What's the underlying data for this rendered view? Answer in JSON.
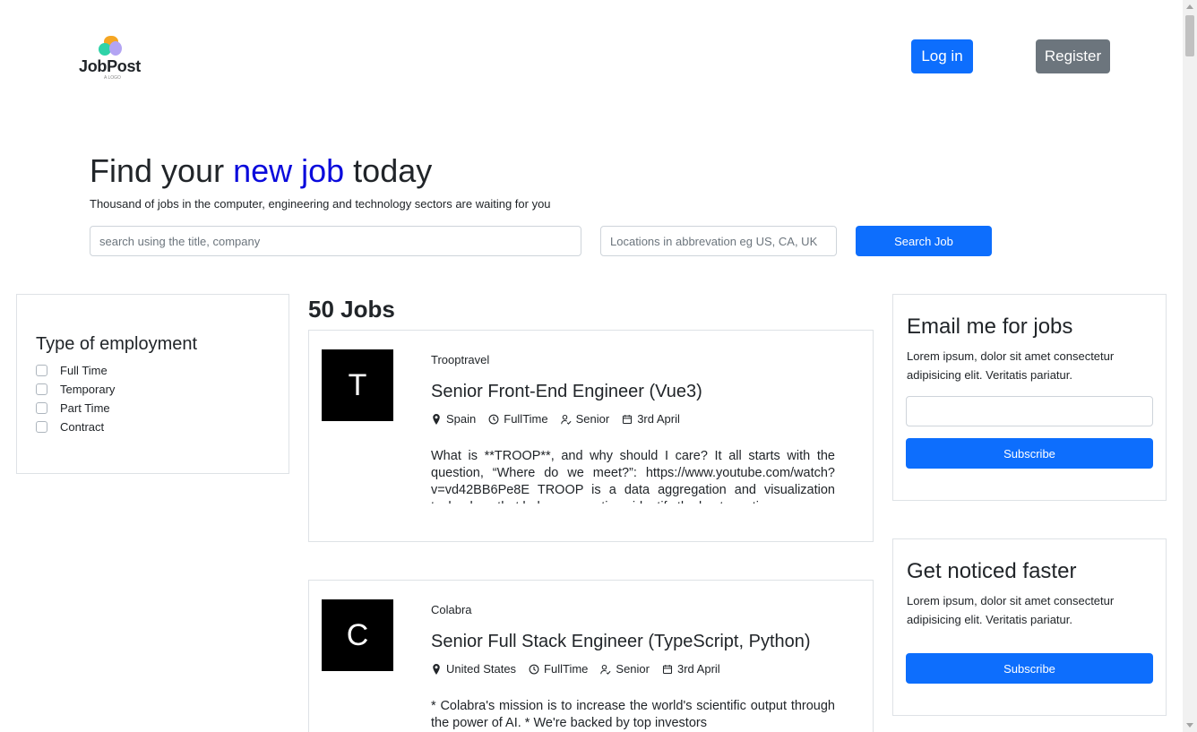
{
  "header": {
    "logo_text": "JobPost",
    "logo_sub": "A LOGO",
    "login_label": "Log in",
    "register_label": "Register"
  },
  "hero": {
    "title_before": "Find your ",
    "title_accent": "new job",
    "title_after": " today",
    "subtitle": "Thousand of jobs in the computer, engineering and technology sectors are waiting for you",
    "search_placeholder": "search using the title, company",
    "location_placeholder": "Locations in abbrevation eg US, CA, UK",
    "search_button": "Search Job"
  },
  "filters": {
    "title": "Type of employment",
    "options": [
      "Full Time",
      "Temporary",
      "Part Time",
      "Contract"
    ]
  },
  "jobs": {
    "count_label": "50 Jobs",
    "items": [
      {
        "initial": "T",
        "company": "Trooptravel",
        "title": "Senior Front-End Engineer (Vue3)",
        "location": "Spain",
        "type": "FullTime",
        "level": "Senior",
        "date": "3rd April",
        "description": "What is **TROOP**, and why should I care? It all starts with the question, “Where do we meet?”: https://www.youtube.com/watch?v=vd42BB6Pe8E TROOP is a data aggregation and visualization technology that helps corporations identify the best meeting"
      },
      {
        "initial": "C",
        "company": "Colabra",
        "title": "Senior Full Stack Engineer (TypeScript, Python)",
        "location": "United States",
        "type": "FullTime",
        "level": "Senior",
        "date": "3rd April",
        "description": "* Colabra's mission is to increase the world's scientific output through the power of AI. * We're backed by top investors"
      }
    ]
  },
  "email_panel": {
    "title": "Email me for jobs",
    "text": "Lorem ipsum, dolor sit amet consectetur adipisicing elit. Veritatis pariatur.",
    "button": "Subscribe"
  },
  "noticed_panel": {
    "title": "Get noticed faster",
    "text": "Lorem ipsum, dolor sit amet consectetur adipisicing elit. Veritatis pariatur.",
    "button": "Subscribe"
  },
  "colors": {
    "primary": "#0d6efd",
    "secondary": "#6c757d",
    "accent": "#0a0adc"
  }
}
